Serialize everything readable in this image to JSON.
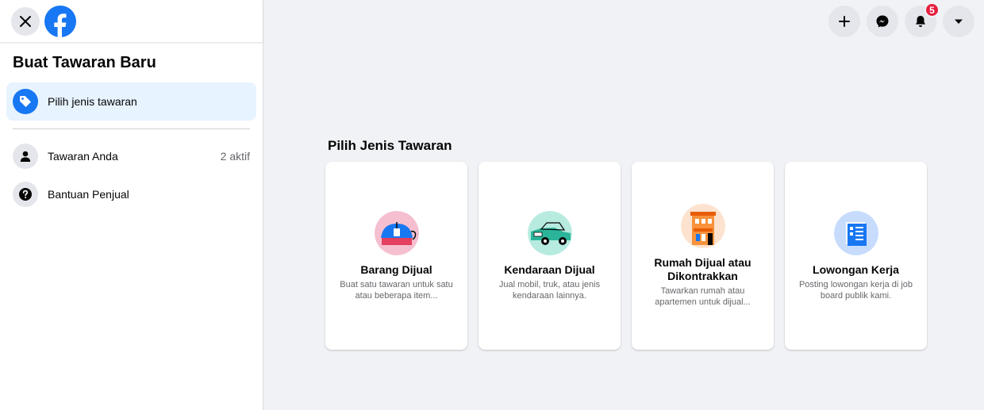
{
  "sidebar": {
    "title": "Buat Tawaran Baru",
    "items": [
      {
        "label": "Pilih jenis tawaran",
        "icon": "tag-icon"
      },
      {
        "label": "Tawaran Anda",
        "count": "2 aktif",
        "icon": "person-icon"
      },
      {
        "label": "Bantuan Penjual",
        "icon": "question-icon"
      }
    ]
  },
  "topbar": {
    "notification_count": "5",
    "icons": [
      "plus-icon",
      "messenger-icon",
      "bell-icon",
      "caret-down-icon"
    ]
  },
  "main": {
    "heading": "Pilih Jenis Tawaran",
    "cards": [
      {
        "title": "Barang Dijual",
        "desc": "Buat satu tawaran untuk satu atau beberapa item..."
      },
      {
        "title": "Kendaraan Dijual",
        "desc": "Jual mobil, truk, atau jenis kendaraan lainnya."
      },
      {
        "title": "Rumah Dijual atau Dikontrakkan",
        "desc": "Tawarkan rumah atau apartemen untuk dijual..."
      },
      {
        "title": "Lowongan Kerja",
        "desc": "Posting lowongan kerja di job board publik kami."
      }
    ]
  },
  "colors": {
    "accent": "#1877f2",
    "active_bg": "#e7f3ff",
    "badge": "#e41e3f"
  }
}
